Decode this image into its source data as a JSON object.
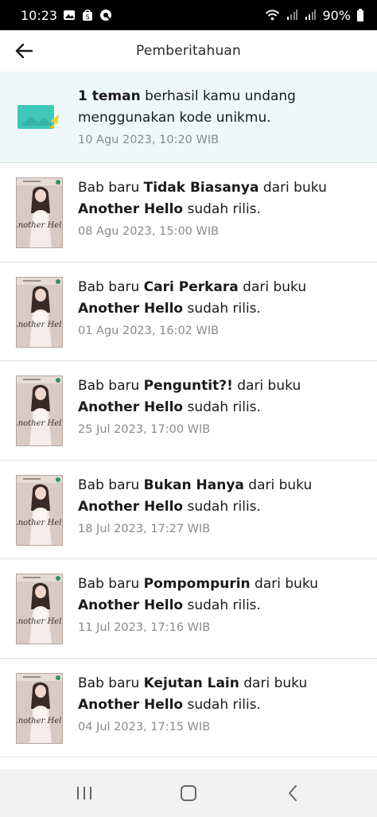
{
  "status_bar": {
    "time": "10:23",
    "battery": "90%"
  },
  "header": {
    "title": "Pemberitahuan"
  },
  "invite": {
    "bold": "1 teman",
    "text": " berhasil kamu undang menggunakan kode unikmu.",
    "date": "10 Agu 2023, 10:20 WIB"
  },
  "notifications": [
    {
      "prefix": "Bab baru ",
      "chapter": "Tidak Biasanya",
      "mid": " dari buku ",
      "book": "Another Hello",
      "suffix": " sudah rilis.",
      "date": "08 Agu 2023, 15:00 WIB"
    },
    {
      "prefix": "Bab baru ",
      "chapter": "Cari Perkara",
      "mid": " dari buku ",
      "book": "Another Hello",
      "suffix": " sudah rilis.",
      "date": "01 Agu 2023, 16:02 WIB"
    },
    {
      "prefix": "Bab baru ",
      "chapter": "Penguntit?!",
      "mid": " dari buku ",
      "book": "Another Hello",
      "suffix": " sudah rilis.",
      "date": "25 Jul 2023, 17:00 WIB"
    },
    {
      "prefix": "Bab baru ",
      "chapter": "Bukan Hanya",
      "mid": " dari buku ",
      "book": "Another Hello",
      "suffix": " sudah rilis.",
      "date": "18 Jul 2023, 17:27 WIB"
    },
    {
      "prefix": "Bab baru ",
      "chapter": "Pompompurin",
      "mid": " dari buku ",
      "book": "Another Hello",
      "suffix": " sudah rilis.",
      "date": "11 Jul 2023, 17:16 WIB"
    },
    {
      "prefix": "Bab baru ",
      "chapter": "Kejutan Lain",
      "mid": " dari buku ",
      "book": "Another Hello",
      "suffix": " sudah rilis.",
      "date": "04 Jul 2023, 17:15 WIB"
    }
  ],
  "cover": {
    "title": "Another Hello"
  },
  "icons": {
    "back": "arrow-left-icon",
    "nav_recent": "recent-apps-icon",
    "nav_home": "home-icon",
    "nav_back": "back-icon"
  }
}
